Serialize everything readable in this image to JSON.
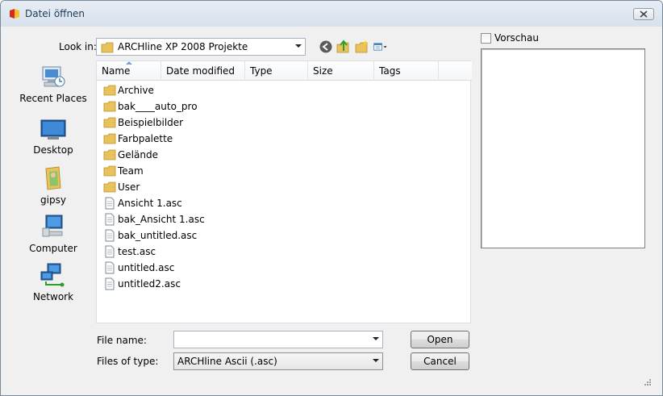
{
  "window": {
    "title": "Datei öffnen"
  },
  "toolbar": {
    "look_in_label": "Look in:",
    "look_in_value": "ARCHline XP 2008 Projekte",
    "icons": [
      "back-icon",
      "up-folder-icon",
      "new-folder-icon",
      "views-menu-icon"
    ]
  },
  "places": [
    {
      "label": "Recent Places",
      "icon": "recent-places-icon"
    },
    {
      "label": "Desktop",
      "icon": "desktop-icon"
    },
    {
      "label": "gipsy",
      "icon": "user-folder-icon"
    },
    {
      "label": "Computer",
      "icon": "computer-icon"
    },
    {
      "label": "Network",
      "icon": "network-icon"
    }
  ],
  "columns": [
    "Name",
    "Date modified",
    "Type",
    "Size",
    "Tags"
  ],
  "files": [
    {
      "name": "Archive",
      "kind": "folder"
    },
    {
      "name": "bak____auto_pro",
      "kind": "folder"
    },
    {
      "name": "Beispielbilder",
      "kind": "folder"
    },
    {
      "name": "Farbpalette",
      "kind": "folder"
    },
    {
      "name": "Gelände",
      "kind": "folder"
    },
    {
      "name": "Team",
      "kind": "folder"
    },
    {
      "name": "User",
      "kind": "folder"
    },
    {
      "name": "Ansicht 1.asc",
      "kind": "file"
    },
    {
      "name": "bak_Ansicht 1.asc",
      "kind": "file"
    },
    {
      "name": "bak_untitled.asc",
      "kind": "file"
    },
    {
      "name": "test.asc",
      "kind": "file"
    },
    {
      "name": "untitled.asc",
      "kind": "file"
    },
    {
      "name": "untitled2.asc",
      "kind": "file"
    }
  ],
  "preview": {
    "label": "Vorschau",
    "checked": false
  },
  "form": {
    "file_name_label": "File name:",
    "file_name_value": "",
    "files_of_type_label": "Files of type:",
    "files_of_type_value": "ARCHline Ascii (.asc)"
  },
  "buttons": {
    "open": "Open",
    "cancel": "Cancel"
  },
  "colors": {
    "folder": "#e9c25a",
    "title_text": "#1e395b",
    "accent": "#3c7fb1"
  }
}
